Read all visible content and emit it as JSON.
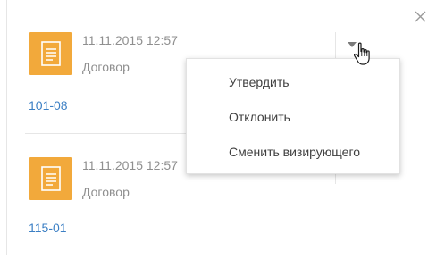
{
  "panel": {
    "close_icon": "close-icon",
    "actions_icon": "chevron-down-icon",
    "document_icon": "document-icon",
    "tile_color": "#f2a93b",
    "link_color": "#3b7fc4"
  },
  "items": [
    {
      "date": "11.11.2015 12:57",
      "type": "Договор",
      "number": "101-08"
    },
    {
      "date": "11.11.2015 12:57",
      "type": "Договор",
      "number": "115-01"
    }
  ],
  "menu": {
    "items": [
      {
        "label": "Утвердить"
      },
      {
        "label": "Отклонить"
      },
      {
        "label": "Сменить визирующего"
      }
    ]
  }
}
